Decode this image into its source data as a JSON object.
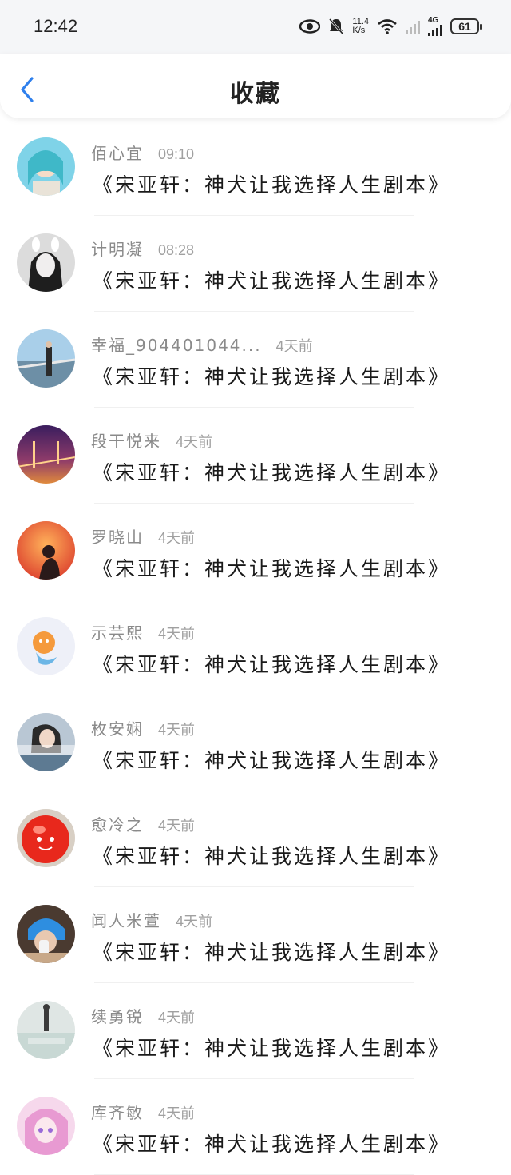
{
  "status": {
    "time": "12:42",
    "net_speed_top": "11.4",
    "net_speed_bottom": "K/s",
    "network_type": "4G",
    "battery": "61",
    "icons": [
      "eye-icon",
      "bell-muted-icon",
      "wifi-icon",
      "signal-icon",
      "signal-4g-icon",
      "battery-icon"
    ]
  },
  "header": {
    "title": "收藏",
    "back_icon": "chevron-left-icon",
    "accent": "#2f80ed"
  },
  "items": [
    {
      "name": "佰心宜",
      "time": "09:10",
      "title": "《宋亚轩：神犬让我选择人生剧本》"
    },
    {
      "name": "计明凝",
      "time": "08:28",
      "title": "《宋亚轩：神犬让我选择人生剧本》"
    },
    {
      "name": "幸福_904401044...",
      "time": "4天前",
      "title": "《宋亚轩：神犬让我选择人生剧本》"
    },
    {
      "name": "段干悦来",
      "time": "4天前",
      "title": "《宋亚轩：神犬让我选择人生剧本》"
    },
    {
      "name": "罗晓山",
      "time": "4天前",
      "title": "《宋亚轩：神犬让我选择人生剧本》"
    },
    {
      "name": "示芸熙",
      "time": "4天前",
      "title": "《宋亚轩：神犬让我选择人生剧本》"
    },
    {
      "name": "枚安娴",
      "time": "4天前",
      "title": "《宋亚轩：神犬让我选择人生剧本》"
    },
    {
      "name": "愈冷之",
      "time": "4天前",
      "title": "《宋亚轩：神犬让我选择人生剧本》"
    },
    {
      "name": "闻人米萱",
      "time": "4天前",
      "title": "《宋亚轩：神犬让我选择人生剧本》"
    },
    {
      "name": "续勇锐",
      "time": "4天前",
      "title": "《宋亚轩：神犬让我选择人生剧本》"
    },
    {
      "name": "库齐敏",
      "time": "4天前",
      "title": "《宋亚轩：神犬让我选择人生剧本》"
    }
  ]
}
